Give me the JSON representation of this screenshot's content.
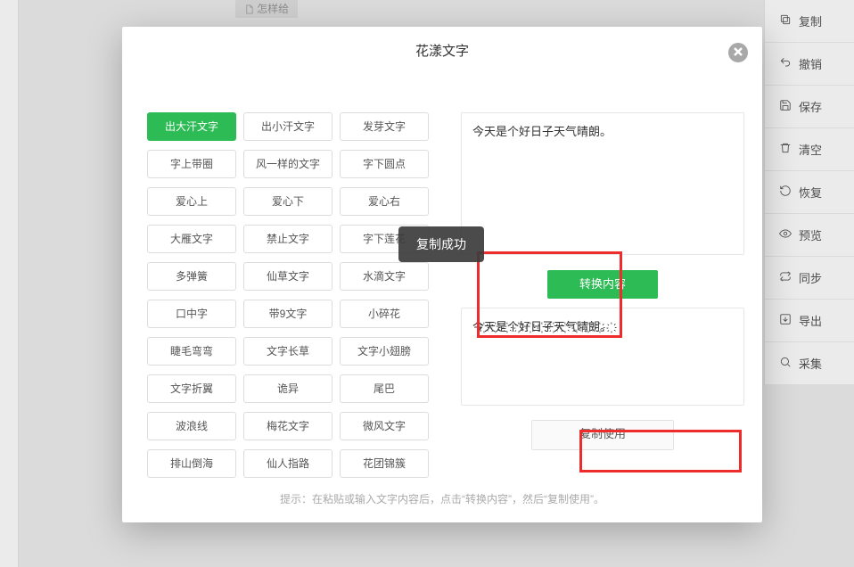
{
  "background": {
    "tab_label": "怎样给"
  },
  "sidebar": {
    "items": [
      {
        "label": "复制",
        "icon": "copy-icon"
      },
      {
        "label": "撤销",
        "icon": "undo-icon"
      },
      {
        "label": "保存",
        "icon": "save-icon"
      },
      {
        "label": "清空",
        "icon": "trash-icon"
      },
      {
        "label": "恢复",
        "icon": "restore-icon"
      },
      {
        "label": "预览",
        "icon": "eye-icon"
      },
      {
        "label": "同步",
        "icon": "sync-icon"
      },
      {
        "label": "导出",
        "icon": "export-icon"
      },
      {
        "label": "采集",
        "icon": "collect-icon"
      }
    ]
  },
  "modal": {
    "title": "花漾文字",
    "close_label": "close",
    "options": [
      "出大汗文字",
      "出小汗文字",
      "发芽文字",
      "字上带圈",
      "风一样的文字",
      "字下圆点",
      "爱心上",
      "爱心下",
      "爱心右",
      "大雁文字",
      "禁止文字",
      "字下莲花",
      "多弹簧",
      "仙草文字",
      "水滴文字",
      "口中字",
      "带9文字",
      "小碎花",
      "睫毛弯弯",
      "文字长草",
      "文字小翅膀",
      "文字折翼",
      "诡异",
      "尾巴",
      "波浪线",
      "梅花文字",
      "微风文字",
      "排山倒海",
      "仙人指路",
      "花团锦簇"
    ],
    "active_index": 0,
    "input_text": "今天是个好日子天气晴朗。",
    "convert_label": "转换内容",
    "output_text": "今҉天҉是҉个҉好҉日҉子҉天҉气҉晴҉朗҉。҉",
    "copy_use_label": "复制使用",
    "hint": "提示：在粘贴或输入文字内容后，点击“转换内容”，然后“复制使用”。"
  },
  "toast": {
    "message": "复制成功"
  }
}
